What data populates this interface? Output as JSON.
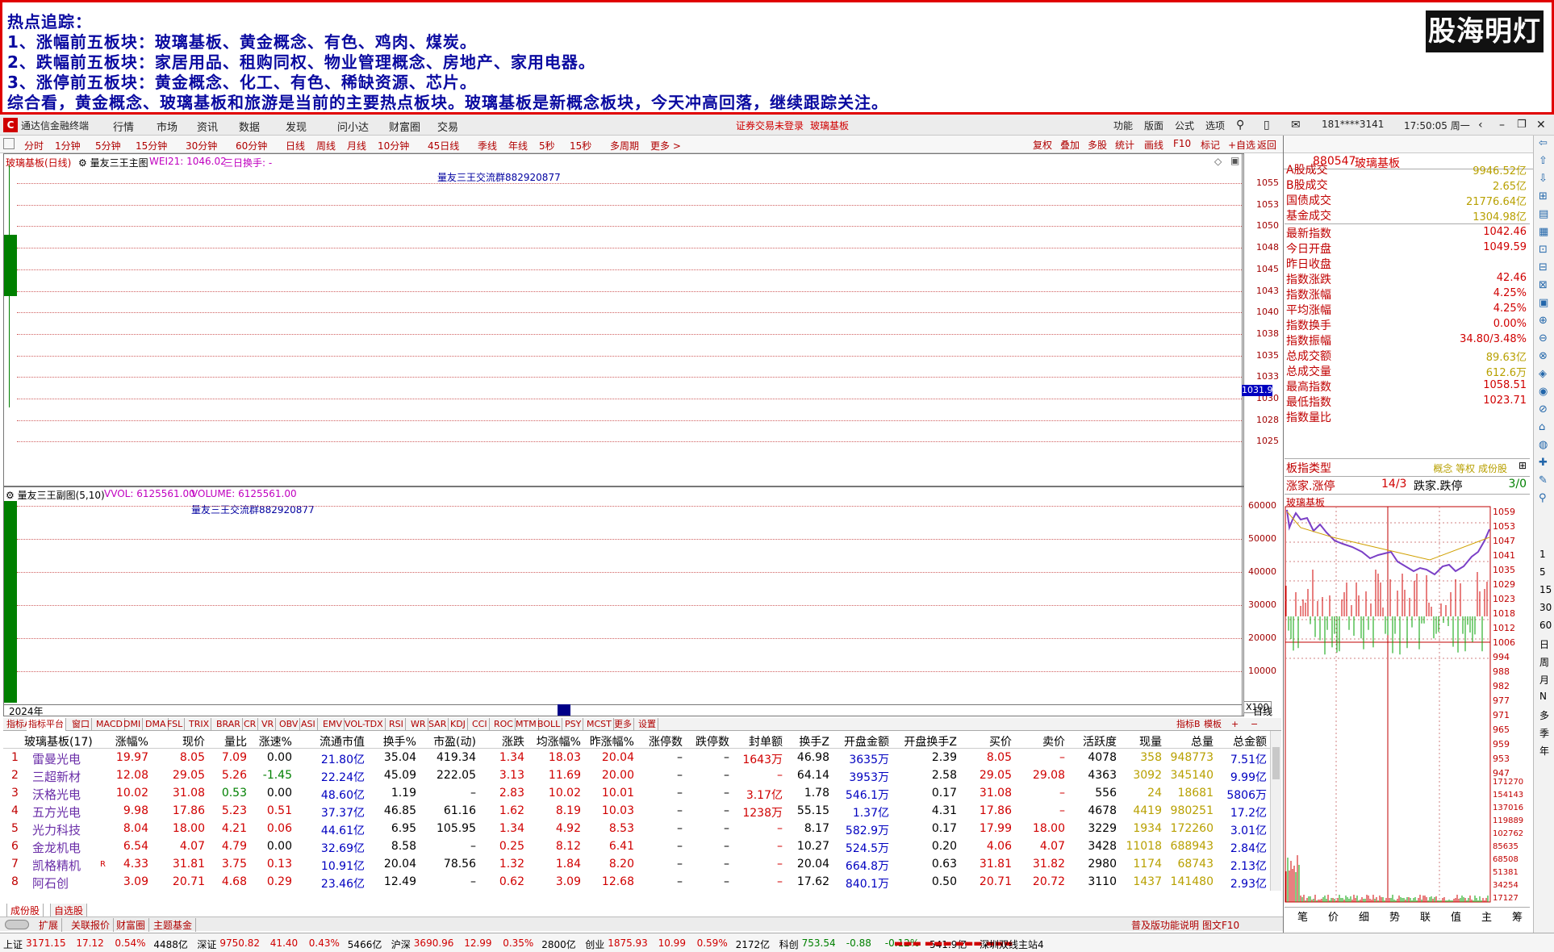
{
  "banner": {
    "lines": [
      "热点追踪：",
      "1、涨幅前五板块：玻璃基板、黄金概念、有色、鸡肉、煤炭。",
      "2、跌幅前五板块：家居用品、租购同权、物业管理概念、房地产、家用电器。",
      "3、涨停前五板块：黄金概念、化工、有色、稀缺资源、芯片。",
      "综合看，黄金概念、玻璃基板和旅游是当前的主要热点板块。玻璃基板是新概念板块，今天冲高回落，继续跟踪关注。"
    ],
    "logo": "股海明灯"
  },
  "menubar": {
    "app_title": "通达信金融终端",
    "items": [
      "行情",
      "市场",
      "资讯",
      "数据",
      "发现",
      "问小达",
      "财富圈",
      "交易"
    ],
    "center_notice": "证券交易未登录",
    "center_name": "玻璃基板",
    "right_items": [
      "功能",
      "版面",
      "公式",
      "选项"
    ],
    "account": "181****3141",
    "time": "17:50:05 周一"
  },
  "periodbar": {
    "items": [
      "分时",
      "1分钟",
      "5分钟",
      "15分钟",
      "30分钟",
      "60分钟",
      "日线",
      "周线",
      "月线",
      "10分钟",
      "45日线",
      "季线",
      "年线",
      "5秒",
      "15秒",
      "多周期",
      "更多 >"
    ],
    "tools": [
      "复权",
      "叠加",
      "多股",
      "统计",
      "画线",
      "F10",
      "标记",
      "+自选",
      "返回"
    ]
  },
  "main_chart": {
    "title": "玻璃基板(日线)",
    "indicator": "量友三王主图",
    "wei": "WEI21: 1046.02",
    "turnover": "三日换手: -",
    "watermark": "量友三王交流群882920877",
    "price_tag": "1031.9",
    "y_ticks": [
      "1055",
      "1053",
      "1050",
      "1048",
      "1045",
      "1043",
      "1040",
      "1038",
      "1035",
      "1033",
      "1030",
      "1028",
      "1025"
    ]
  },
  "sub_chart": {
    "title": "量友三王副图(5,10)",
    "vvol": "VVOL: 6125561.00",
    "volume": "VOLUME: 6125561.00",
    "watermark": "量友三王交流群882920877",
    "y_ticks": [
      "60000",
      "50000",
      "40000",
      "30000",
      "20000",
      "10000"
    ],
    "unit": "X100",
    "year": "2024年",
    "period": "日线"
  },
  "indicator_tabs": {
    "left": [
      "指标A",
      "指标平台",
      "窗口",
      "MACD",
      "DMI",
      "DMA",
      "FSL",
      "TRIX",
      "BRAR",
      "CR",
      "VR",
      "OBV",
      "ASI",
      "EMV",
      "VOL-TDX",
      "RSI",
      "WR",
      "SAR",
      "KDJ",
      "CCI",
      "ROC",
      "MTM",
      "BOLL",
      "PSY",
      "MCST",
      "更多",
      "设置"
    ],
    "right": [
      "指标B",
      "模板",
      "+",
      "−"
    ]
  },
  "right_panel": {
    "code": "880547",
    "name": "玻璃基板",
    "rows": [
      {
        "k": "A股成交",
        "v": "9946.52亿",
        "c": "#b8a000"
      },
      {
        "k": "B股成交",
        "v": "2.65亿",
        "c": "#b8a000"
      },
      {
        "k": "国债成交",
        "v": "21776.64亿",
        "c": "#b8a000"
      },
      {
        "k": "基金成交",
        "v": "1304.98亿",
        "c": "#b8a000"
      },
      {
        "k": "最新指数",
        "v": "1042.46",
        "c": "#d00000"
      },
      {
        "k": "今日开盘",
        "v": "1049.59",
        "c": "#d00000"
      },
      {
        "k": "昨日收盘",
        "v": "",
        "c": "#000"
      },
      {
        "k": "指数涨跌",
        "v": "42.46",
        "c": "#d00000"
      },
      {
        "k": "指数涨幅",
        "v": "4.25%",
        "c": "#d00000"
      },
      {
        "k": "平均涨幅",
        "v": "4.25%",
        "c": "#d00000"
      },
      {
        "k": "指数换手",
        "v": "0.00%",
        "c": "#d00000"
      },
      {
        "k": "指数振幅",
        "v": "34.80/3.48%",
        "c": "#d00000"
      },
      {
        "k": "总成交额",
        "v": "89.63亿",
        "c": "#b8a000"
      },
      {
        "k": "总成交量",
        "v": "612.6万",
        "c": "#b8a000"
      },
      {
        "k": "最高指数",
        "v": "1058.51",
        "c": "#d00000"
      },
      {
        "k": "最低指数",
        "v": "1023.71",
        "c": "#d00000"
      },
      {
        "k": "指数量比",
        "v": "",
        "c": "#000"
      }
    ],
    "board_type_label": "板指类型",
    "board_type_value": "概念 等权 成份股",
    "updown_label": "涨家.涨停",
    "updown_value": "14/3",
    "down_label": "跌家.跌停",
    "down_value": "3/0",
    "mini_title": "玻璃基板",
    "mini_price_ticks": [
      "1059",
      "1053",
      "1047",
      "1041",
      "1035",
      "1029",
      "1023",
      "1018",
      "1012",
      "1006",
      "994",
      "988",
      "982",
      "977",
      "971",
      "965",
      "959",
      "953",
      "947"
    ],
    "mini_vol_ticks": [
      "171270",
      "154143",
      "137016",
      "119889",
      "102762",
      "85635",
      "68508",
      "51381",
      "34254",
      "17127"
    ],
    "bottom_tabs": [
      "笔",
      "价",
      "细",
      "势",
      "联",
      "值",
      "主",
      "筹"
    ]
  },
  "side_toolbar": [
    "1",
    "5",
    "15",
    "30",
    "60",
    "日",
    "周",
    "月",
    "N",
    "多",
    "季",
    "年"
  ],
  "table": {
    "headers": [
      "玻璃基板(17)",
      "涨幅%",
      "现价",
      "量比",
      "涨速%",
      "流通市值",
      "换手%",
      "市盈(动)",
      "涨跌",
      "均涨幅%",
      "昨涨幅%",
      "涨停数",
      "跌停数",
      "封单额",
      "换手Z",
      "开盘金额",
      "开盘换手Z",
      "买价",
      "卖价",
      "活跃度",
      "现量",
      "总量",
      "总金额"
    ],
    "rows": [
      [
        "1",
        "雷曼光电",
        "",
        "19.97",
        "8.05",
        "7.09",
        "0.00",
        "21.80亿",
        "35.04",
        "419.34",
        "1.34",
        "18.03",
        "20.04",
        "–",
        "–",
        "1643万",
        "46.98",
        "3635万",
        "2.39",
        "8.05",
        "–",
        "4078",
        "358",
        "948773",
        "7.51亿"
      ],
      [
        "2",
        "三超新材",
        "",
        "12.08",
        "29.05",
        "5.26",
        "-1.45",
        "22.24亿",
        "45.09",
        "222.05",
        "3.13",
        "11.69",
        "20.00",
        "–",
        "–",
        "–",
        "64.14",
        "3953万",
        "2.58",
        "29.05",
        "29.08",
        "4363",
        "3092",
        "345140",
        "9.99亿"
      ],
      [
        "3",
        "沃格光电",
        "",
        "10.02",
        "31.08",
        "0.53",
        "0.00",
        "48.60亿",
        "1.19",
        "–",
        "2.83",
        "10.02",
        "10.01",
        "–",
        "–",
        "3.17亿",
        "1.78",
        "546.1万",
        "0.17",
        "31.08",
        "–",
        "556",
        "24",
        "18681",
        "5806万"
      ],
      [
        "4",
        "五方光电",
        "",
        "9.98",
        "17.86",
        "5.23",
        "0.51",
        "37.37亿",
        "46.85",
        "61.16",
        "1.62",
        "8.19",
        "10.03",
        "–",
        "–",
        "1238万",
        "55.15",
        "1.37亿",
        "4.31",
        "17.86",
        "–",
        "4678",
        "4419",
        "980251",
        "17.2亿"
      ],
      [
        "5",
        "光力科技",
        "",
        "8.04",
        "18.00",
        "4.21",
        "0.06",
        "44.61亿",
        "6.95",
        "105.95",
        "1.34",
        "4.92",
        "8.53",
        "–",
        "–",
        "–",
        "8.17",
        "582.9万",
        "0.17",
        "17.99",
        "18.00",
        "3229",
        "1934",
        "172260",
        "3.01亿"
      ],
      [
        "6",
        "金龙机电",
        "",
        "6.54",
        "4.07",
        "4.79",
        "0.00",
        "32.69亿",
        "8.58",
        "–",
        "0.25",
        "8.12",
        "6.41",
        "–",
        "–",
        "–",
        "10.27",
        "524.5万",
        "0.20",
        "4.06",
        "4.07",
        "3428",
        "11018",
        "688943",
        "2.84亿"
      ],
      [
        "7",
        "凯格精机",
        "R",
        "4.33",
        "31.81",
        "3.75",
        "0.13",
        "10.91亿",
        "20.04",
        "78.56",
        "1.32",
        "1.84",
        "8.20",
        "–",
        "–",
        "–",
        "20.04",
        "664.8万",
        "0.63",
        "31.81",
        "31.82",
        "2980",
        "1174",
        "68743",
        "2.13亿"
      ],
      [
        "8",
        "阿石创",
        "",
        "3.09",
        "20.71",
        "4.68",
        "0.29",
        "23.46亿",
        "12.49",
        "–",
        "0.62",
        "3.09",
        "12.68",
        "–",
        "–",
        "–",
        "17.62",
        "840.1万",
        "0.50",
        "20.71",
        "20.72",
        "3110",
        "1437",
        "141480",
        "2.93亿"
      ]
    ],
    "tabs": [
      "成份股",
      "自选股"
    ],
    "bottom_tabs": [
      "扩展",
      "关联报价",
      "财富圈",
      "主题基金"
    ],
    "right_tabs": [
      "普及版功能说明",
      "图文F10"
    ]
  },
  "statusbar": {
    "items": [
      {
        "name": "上证",
        "vals": [
          "3171.15",
          "17.12",
          "0.54%",
          "4488亿"
        ]
      },
      {
        "name": "深证",
        "vals": [
          "9750.82",
          "41.40",
          "0.43%",
          "5466亿"
        ]
      },
      {
        "name": "沪深",
        "vals": [
          "3690.96",
          "12.99",
          "0.35%",
          "2800亿"
        ]
      },
      {
        "name": "创业",
        "vals": [
          "1875.93",
          "10.99",
          "0.59%",
          "2172亿"
        ]
      },
      {
        "name": "科创",
        "vals": [
          "753.54",
          "-0.88",
          "-0.12%",
          "541.9亿"
        ]
      }
    ],
    "server": "深圳双线主站4"
  },
  "colors": {
    "red": "#d00000",
    "green": "#008000",
    "blue": "#0000c0",
    "frame": "#e00000",
    "yellow": "#b8a000",
    "purple": "#7a3fc6"
  }
}
